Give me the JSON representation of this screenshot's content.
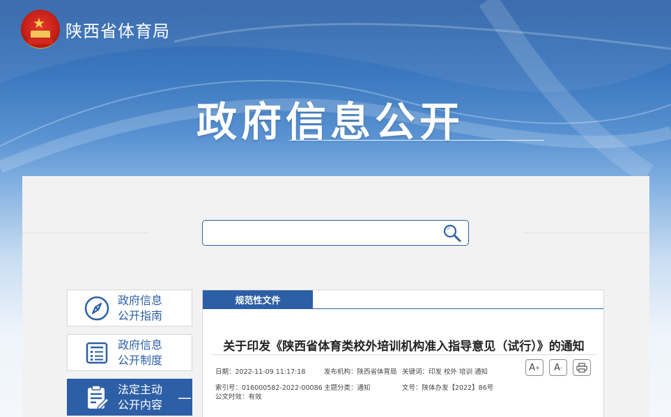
{
  "header": {
    "site_name": "陕西省体育局",
    "emblem_icon": "national-emblem-icon"
  },
  "banner": {
    "title": "政府信息公开"
  },
  "search": {
    "value": "",
    "placeholder": "",
    "icon": "search-icon"
  },
  "sidebar": {
    "items": [
      {
        "line1": "政府信息",
        "line2": "公开指南",
        "icon": "compass-icon",
        "active": false
      },
      {
        "line1": "政府信息",
        "line2": "公开制度",
        "icon": "document-list-icon",
        "active": false
      },
      {
        "line1": "法定主动",
        "line2": "公开内容",
        "icon": "clipboard-edit-icon",
        "active": true,
        "toggle": "—"
      }
    ]
  },
  "content": {
    "tab_label": "规范性文件",
    "doc_title": "关于印发《陕西省体育类校外培训机构准入指导意见（试行）》的通知",
    "meta": {
      "date": "日期：2022-11-09 11:17:18",
      "publisher": "发布机构：陕西省体育局",
      "keywords": "关键词：印发 校外 培训 通知",
      "index_no": "索引号：016000582-2022-00086",
      "category": "主题分类：通知",
      "doc_no": "文号：陕体办发【2022】86号",
      "validity": "公文时效：有效"
    },
    "tools": {
      "font_increase": "A",
      "font_increase_sup": "+",
      "font_decrease": "A",
      "font_decrease_sup": "-",
      "print_icon": "print-icon"
    }
  },
  "colors": {
    "brand_blue": "#2d5fa6",
    "panel_bg": "#f2f2f2"
  }
}
